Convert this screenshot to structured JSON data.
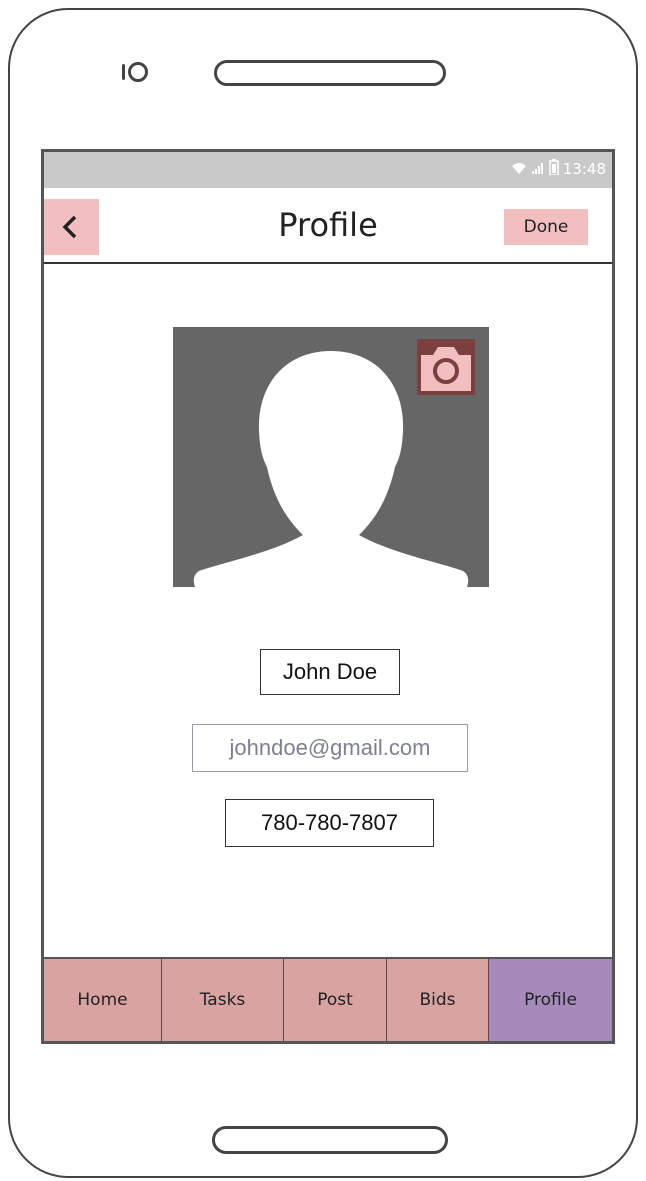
{
  "status_bar": {
    "time": "13:48",
    "icons": [
      "wifi-icon",
      "signal-icon",
      "battery-icon"
    ]
  },
  "header": {
    "back_icon": "chevron-left-icon",
    "title": "Profile",
    "done_label": "Done"
  },
  "profile": {
    "avatar_icon": "person-silhouette-icon",
    "camera_icon": "camera-icon",
    "name": "John Doe",
    "email": "johndoe@gmail.com",
    "phone": "780-780-7807"
  },
  "tabs": [
    {
      "label": "Home",
      "active": false
    },
    {
      "label": "Tasks",
      "active": false
    },
    {
      "label": "Post",
      "active": false
    },
    {
      "label": "Bids",
      "active": false
    },
    {
      "label": "Profile",
      "active": true
    }
  ],
  "colors": {
    "button_pink": "#f1bfbf",
    "tab_pink": "#d9a3a2",
    "tab_active": "#a68ab9",
    "avatar_bg": "#666666",
    "camera_bg": "#7a3f3f",
    "status_bar": "#c9c9c9"
  }
}
